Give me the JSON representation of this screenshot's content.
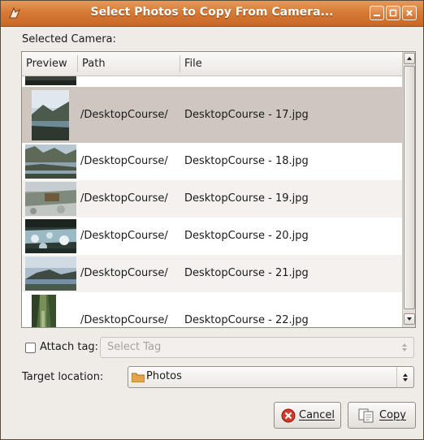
{
  "window": {
    "title": "Select Photos to Copy From Camera..."
  },
  "labels": {
    "selected_camera": "Selected Camera:",
    "attach_tag": "Attach tag:",
    "target_location": "Target location:"
  },
  "columns": {
    "preview": "Preview",
    "path": "Path",
    "file": "File"
  },
  "rows": [
    {
      "path": "/DesktopCourse/",
      "file": "DesktopCourse - 17.jpg",
      "selected": true
    },
    {
      "path": "/DesktopCourse/",
      "file": "DesktopCourse - 18.jpg"
    },
    {
      "path": "/DesktopCourse/",
      "file": "DesktopCourse - 19.jpg"
    },
    {
      "path": "/DesktopCourse/",
      "file": "DesktopCourse - 20.jpg"
    },
    {
      "path": "/DesktopCourse/",
      "file": "DesktopCourse - 21.jpg"
    },
    {
      "path": "/DesktopCourse/",
      "file": "DesktopCourse - 22.jpg"
    }
  ],
  "tag_select": {
    "placeholder": "Select Tag"
  },
  "target_select": {
    "value": "Photos",
    "icon": "folder-icon"
  },
  "buttons": {
    "cancel": "Cancel",
    "copy": "Copy"
  },
  "colors": {
    "titlebar": "#d77a36",
    "selection": "#cfc7bf",
    "alt_row": "#f4f1ee"
  }
}
